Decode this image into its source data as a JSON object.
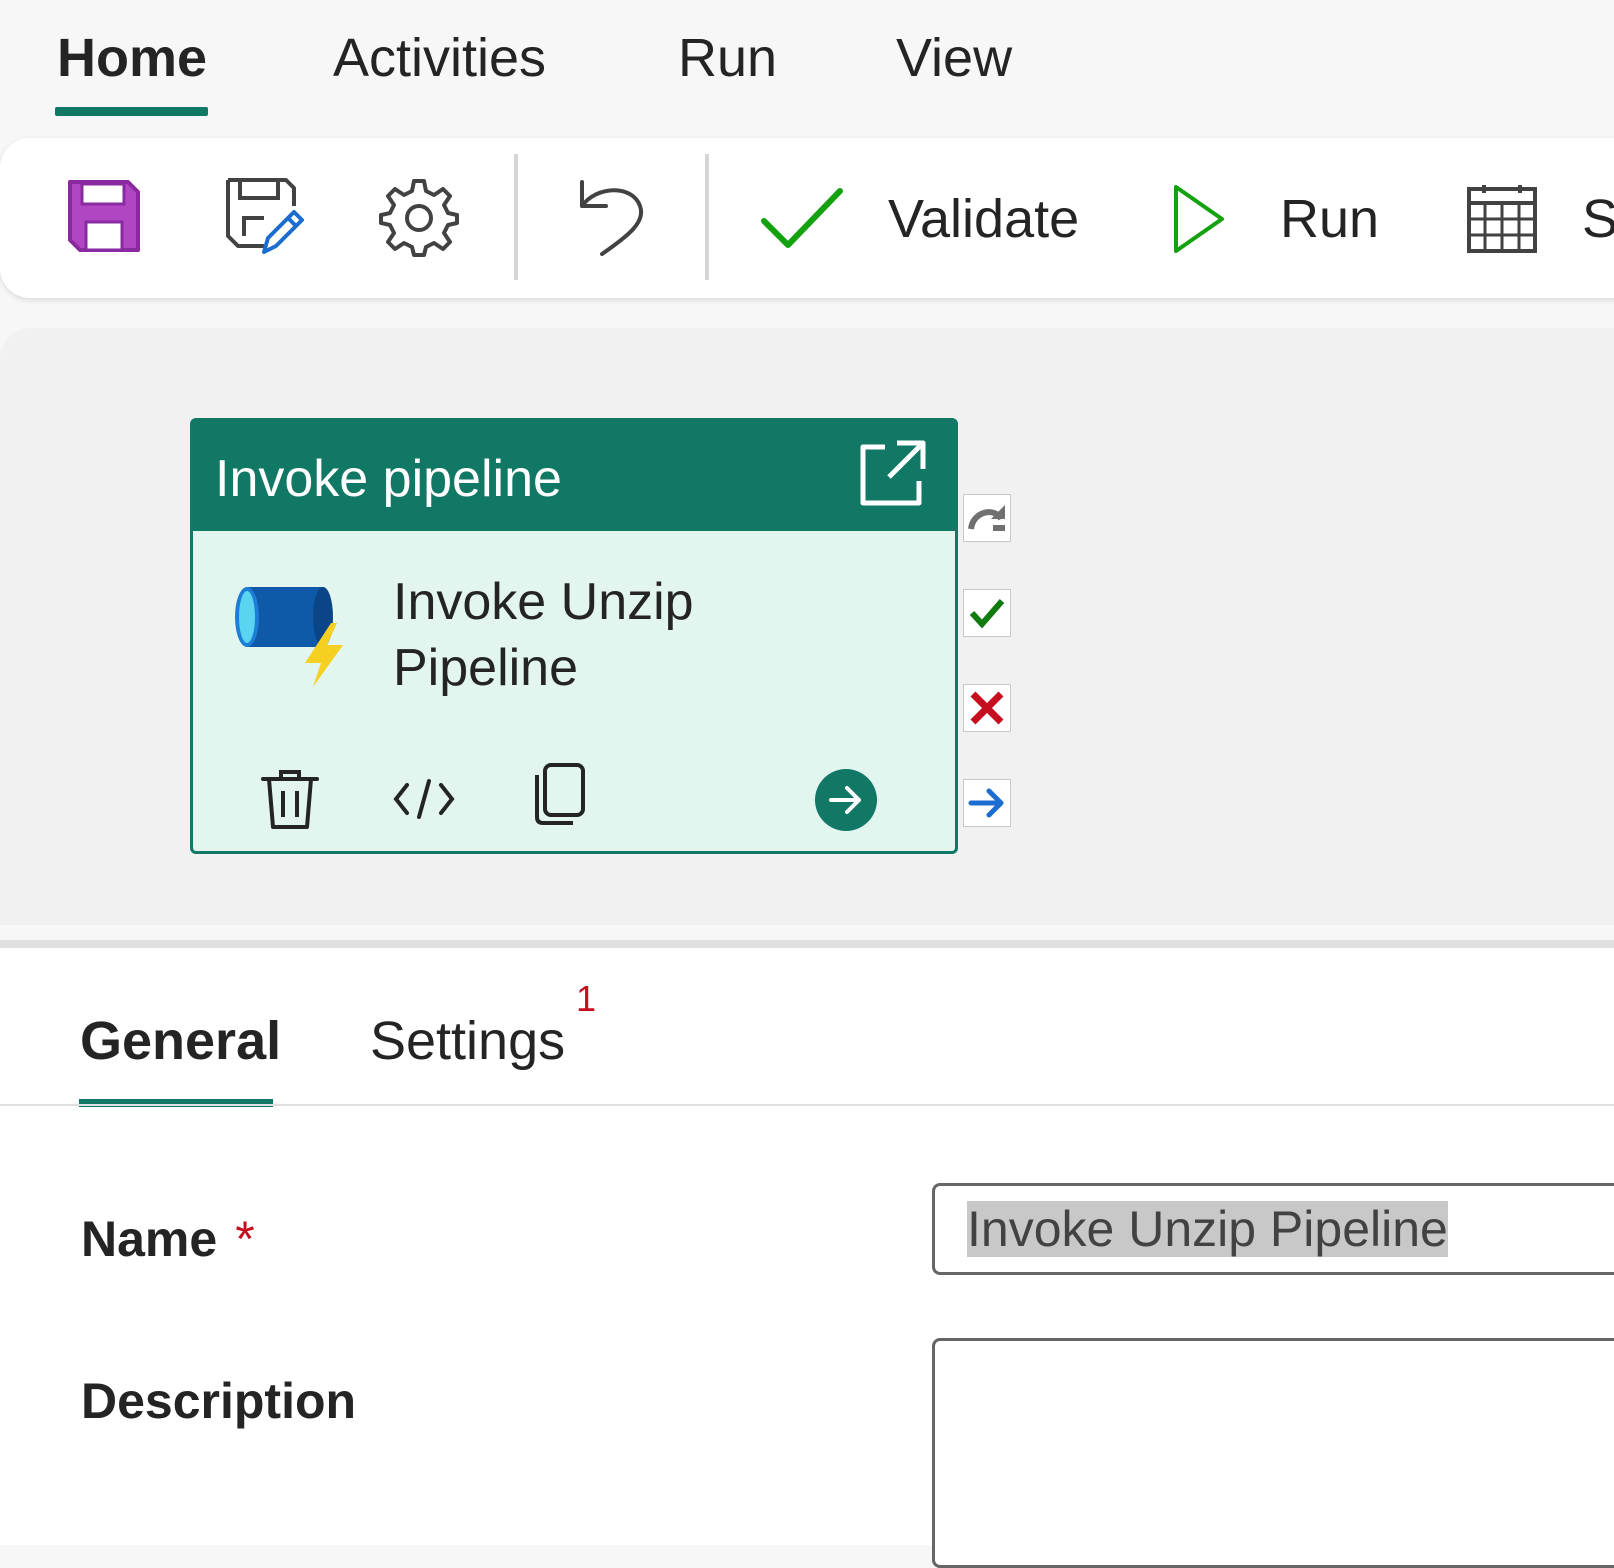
{
  "menu": {
    "tabs": [
      {
        "label": "Home",
        "active": true
      },
      {
        "label": "Activities",
        "active": false
      },
      {
        "label": "Run",
        "active": false
      },
      {
        "label": "View",
        "active": false
      }
    ]
  },
  "toolbar": {
    "save_icon": "save-icon",
    "save_as_icon": "save-as-icon",
    "settings_icon": "gear-icon",
    "undo_icon": "undo-icon",
    "validate_label": "Validate",
    "run_label": "Run",
    "schedule_label_partial": "Sc",
    "accent_green": "#13a10e",
    "save_purple": "#b146c2"
  },
  "canvas": {
    "activity": {
      "type_title": "Invoke pipeline",
      "name_line1": "Invoke Unzip",
      "name_line2": "Pipeline",
      "header_color": "#117865",
      "body_color": "#e2f5ee",
      "icons": [
        "open-external-icon",
        "invoke-pipeline-icon",
        "delete-icon",
        "code-icon",
        "copy-icon",
        "next-arrow-icon"
      ]
    },
    "side_outputs": [
      "skip-icon",
      "success-check-icon",
      "failure-x-icon",
      "completion-arrow-icon"
    ]
  },
  "properties": {
    "tabs": [
      {
        "label": "General",
        "active": true
      },
      {
        "label": "Settings",
        "active": false,
        "badge": "1"
      }
    ],
    "name_label": "Name",
    "required_mark": "*",
    "name_value": "Invoke Unzip Pipeline",
    "description_label": "Description",
    "description_value": ""
  }
}
